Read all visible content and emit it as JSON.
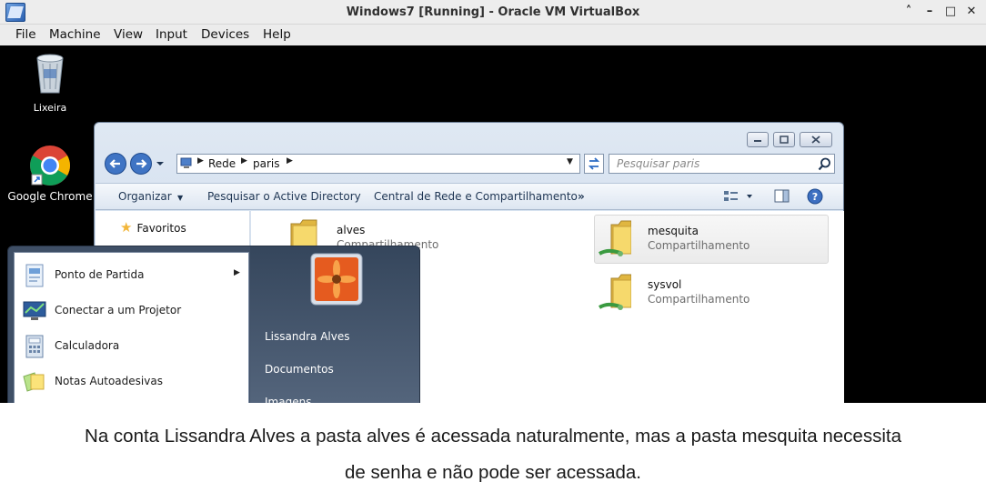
{
  "host_window": {
    "title": "Windows7 [Running] - Oracle VM VirtualBox",
    "controls": {
      "up": "˄",
      "minimize": "–",
      "maximize": "□",
      "close": "✕"
    },
    "menu": [
      "File",
      "Machine",
      "View",
      "Input",
      "Devices",
      "Help"
    ]
  },
  "desktop": {
    "icons": [
      {
        "label": "Lixeira",
        "icon": "recycle-bin-icon"
      },
      {
        "label": "Google Chrome",
        "icon": "chrome-icon"
      }
    ]
  },
  "explorer": {
    "breadcrumb": [
      "Rede",
      "paris"
    ],
    "search_placeholder": "Pesquisar paris",
    "toolbar": {
      "organize": "Organizar",
      "search_ad": "Pesquisar o Active Directory",
      "network_center": "Central de Rede e Compartilhamento",
      "more": "»"
    },
    "nav": {
      "favorites": "Favoritos"
    },
    "folders": [
      {
        "name": "alves",
        "type": "Compartilhamento",
        "selected": false
      },
      {
        "name": "mesquita",
        "type": "Compartilhamento",
        "selected": true
      },
      {
        "name": "sysvol",
        "type": "Compartilhamento",
        "selected": false
      }
    ]
  },
  "start_menu": {
    "programs": [
      {
        "label": "Ponto de Partida",
        "icon": "getting-started-icon",
        "has_submenu": true
      },
      {
        "label": "Conectar a um Projetor",
        "icon": "projector-icon"
      },
      {
        "label": "Calculadora",
        "icon": "calculator-icon"
      },
      {
        "label": "Notas Autoadesivas",
        "icon": "sticky-notes-icon"
      }
    ],
    "user_links": [
      "Lissandra Alves",
      "Documentos",
      "Imagens"
    ]
  },
  "caption": {
    "line1": "Na conta Lissandra Alves a pasta alves é acessada naturalmente, mas a pasta mesquita necessita",
    "line2": "de senha e não pode ser acessada."
  },
  "colors": {
    "guest_background": "#000000",
    "start_menu_right": "#4a5a70",
    "explorer_chrome": "#cfdcec"
  }
}
